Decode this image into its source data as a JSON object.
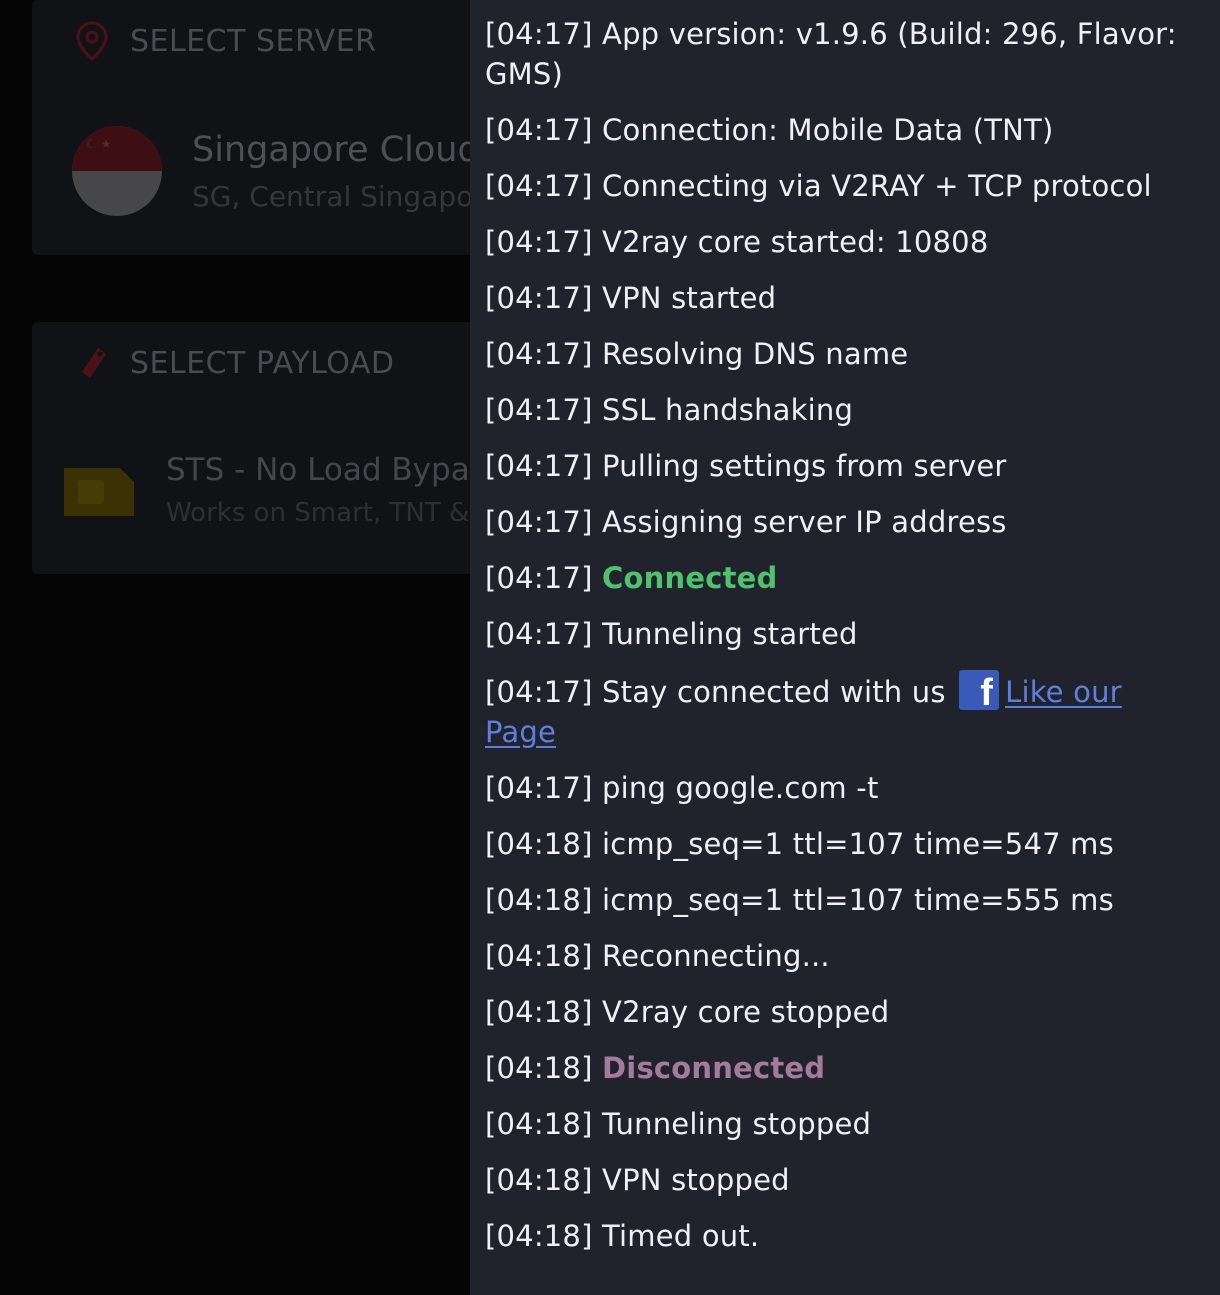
{
  "background_app": {
    "server_card": {
      "title": "SELECT SERVER",
      "server_name": "Singapore Cloud",
      "server_location": "SG, Central Singapore"
    },
    "payload_card": {
      "title": "SELECT PAYLOAD",
      "payload_name": "STS - No Load Bypass",
      "payload_networks": "Works on  Smart, TNT & GOMO"
    }
  },
  "log": {
    "lines": [
      {
        "time": "[04:17]",
        "text": "App version: v1.9.6 (Build: 296, Flavor: GMS)"
      },
      {
        "time": "[04:17]",
        "text": "Connection: Mobile Data (TNT)"
      },
      {
        "time": "[04:17]",
        "text": "Connecting via V2RAY + TCP protocol"
      },
      {
        "time": "[04:17]",
        "text": "V2ray core started: 10808"
      },
      {
        "time": "[04:17]",
        "text": "VPN started"
      },
      {
        "time": "[04:17]",
        "text": "Resolving DNS name"
      },
      {
        "time": "[04:17]",
        "text": "SSL handshaking"
      },
      {
        "time": "[04:17]",
        "text": "Pulling settings from server"
      },
      {
        "time": "[04:17]",
        "text": "Assigning server IP address"
      },
      {
        "time": "[04:17]",
        "text": "Connected",
        "status": "ok"
      },
      {
        "time": "[04:17]",
        "text": "Tunneling started"
      },
      {
        "time": "[04:17]",
        "text": "Stay connected with us",
        "link_icon": "facebook-icon",
        "link_text": "Like our Page"
      },
      {
        "time": "[04:17]",
        "text": "ping google.com -t"
      },
      {
        "time": "[04:18]",
        "text": "icmp_seq=1 ttl=107 time=547 ms"
      },
      {
        "time": "[04:18]",
        "text": "icmp_seq=1 ttl=107 time=555 ms"
      },
      {
        "time": "[04:18]",
        "text": "Reconnecting..."
      },
      {
        "time": "[04:18]",
        "text": "V2ray core stopped"
      },
      {
        "time": "[04:18]",
        "text": "Disconnected",
        "status": "bad"
      },
      {
        "time": "[04:18]",
        "text": "Tunneling stopped"
      },
      {
        "time": "[04:18]",
        "text": "VPN stopped"
      },
      {
        "time": "[04:18]",
        "text": "Timed out."
      }
    ]
  },
  "colors": {
    "log_background": "#21232c",
    "log_text": "#eef0f6",
    "connected_green": "#4ec26d",
    "disconnected_mauve": "#a57b9b",
    "link_blue": "#5f7fdc",
    "facebook_blue": "#3a5ab8"
  }
}
